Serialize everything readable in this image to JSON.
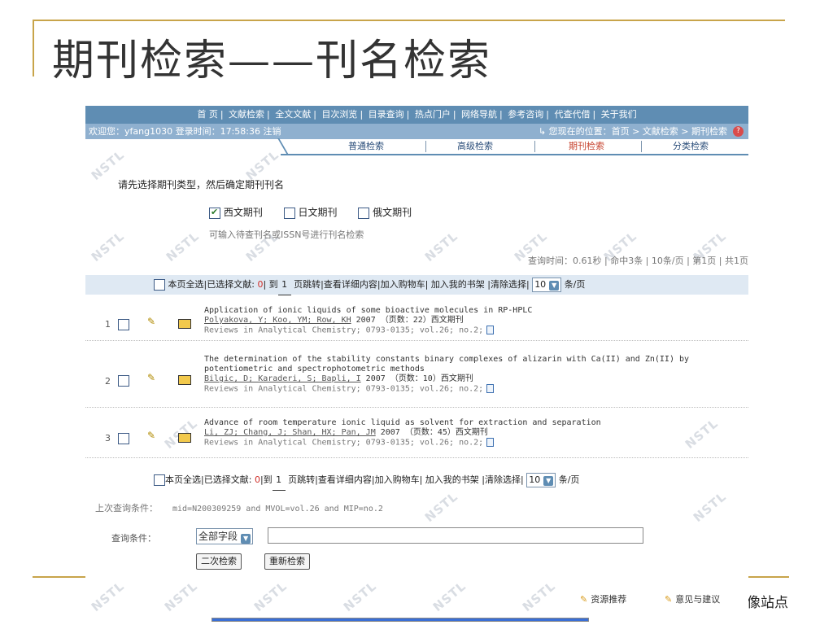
{
  "slide": {
    "title": "期刊检索——刊名检索",
    "tail_text": "像站点"
  },
  "nav": {
    "items": [
      "首 页",
      "文献检索",
      "全文文献",
      "目次浏览",
      "目录查询",
      "热点门户",
      "网络导航",
      "参考咨询",
      "代查代借",
      "关于我们"
    ]
  },
  "welcome": {
    "user_text": "欢迎您：yfang1030 登录时间：17:58:36 注销",
    "location": "您现在的位置：首页 > 文献检索 > 期刊检索"
  },
  "tabs": [
    "普通检索",
    "高级检索",
    "期刊检索",
    "分类检索"
  ],
  "active_tab": "期刊检索",
  "prompt": "请先选择期刊类型，然后确定期刊刊名",
  "journal_types": [
    {
      "label": "西文期刊",
      "checked": true
    },
    {
      "label": "日文期刊",
      "checked": false
    },
    {
      "label": "俄文期刊",
      "checked": false
    }
  ],
  "hint": "可输入待查刊名或ISSN号进行刊名检索",
  "stats": "查询时间：0.61秒 | 命中3条 | 10条/页 | 第1页 | 共1页",
  "toolbar": {
    "select_all": "本页全选",
    "selected_label": "已选择文献:",
    "selected_count": "0",
    "goto_label": "到",
    "page": "1",
    "goto_page": "页跳转",
    "view_detail": "查看详细内容",
    "add_cart": "加入购物车",
    "add_shelf": "加入我的书架",
    "clear": "清除选择",
    "per_page": "10",
    "per_page_unit": "条/页"
  },
  "results": [
    {
      "index": "1",
      "title": "Application of ionic liquids of some bioactive molecules in RP-HPLC",
      "authors": "Polyakova, Y; Koo, YM; Row, KH",
      "meta": " 2007 （页数：22）西文期刊",
      "source": "Reviews in Analytical Chemistry; 0793-0135; vol.26; no.2;"
    },
    {
      "index": "2",
      "title": "The determination of the stability constants binary complexes of alizarin with Ca(II) and Zn(II) by potentiometric and spectrophotometric methods",
      "authors": "Bilgic, D; Karaderi, S; Bapli, I",
      "meta": " 2007 （页数：10）西文期刊",
      "source": "Reviews in Analytical Chemistry; 0793-0135; vol.26; no.2;"
    },
    {
      "index": "3",
      "title": "Advance of room temperature ionic liquid as solvent for extraction and separation",
      "authors": "Li, ZJ; Chang, J; Shan, HX; Pan, JM",
      "meta": " 2007 （页数：45）西文期刊",
      "source": "Reviews in Analytical Chemistry; 0793-0135; vol.26; no.2;"
    }
  ],
  "last_query": {
    "label": "上次查询条件：",
    "value": "mid=N200309259 and MVOL=vol.26 and MIP=no.2"
  },
  "query": {
    "label": "查询条件：",
    "field": "全部字段",
    "value": "",
    "btn_secondary": "二次检索",
    "btn_reset": "重新检索"
  },
  "footer": {
    "recommend": "资源推荐",
    "feedback": "意见与建议"
  },
  "watermark": "NSTL"
}
